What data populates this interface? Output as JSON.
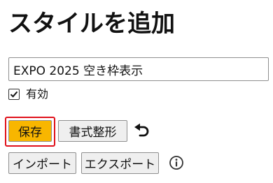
{
  "header": {
    "title": "スタイルを追加"
  },
  "form": {
    "name_value": "EXPO 2025 空き枠表示",
    "enabled_label": "有効",
    "enabled_checked": true
  },
  "toolbar": {
    "save_label": "保存",
    "format_label": "書式整形",
    "undo_icon": "undo-icon",
    "import_label": "インポート",
    "export_label": "エクスポート",
    "info_icon": "info-icon"
  },
  "colors": {
    "save_button_bg": "#f8b600",
    "highlight_border": "#e0101a"
  }
}
